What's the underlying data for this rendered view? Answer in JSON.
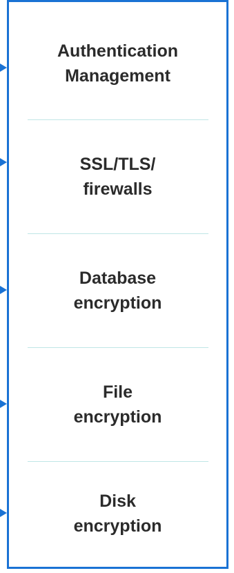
{
  "diagram": {
    "accent_color": "#1a72d4",
    "divider_color": "#bfe6e6",
    "text_color": "#2b2b2b",
    "items": [
      {
        "label": "Authentication\nManagement"
      },
      {
        "label": "SSL/TLS/\nfirewalls"
      },
      {
        "label": "Database\nencryption"
      },
      {
        "label": "File\nencryption"
      },
      {
        "label": "Disk\nencryption"
      }
    ],
    "connector_icon": "arrowhead-right-icon"
  }
}
